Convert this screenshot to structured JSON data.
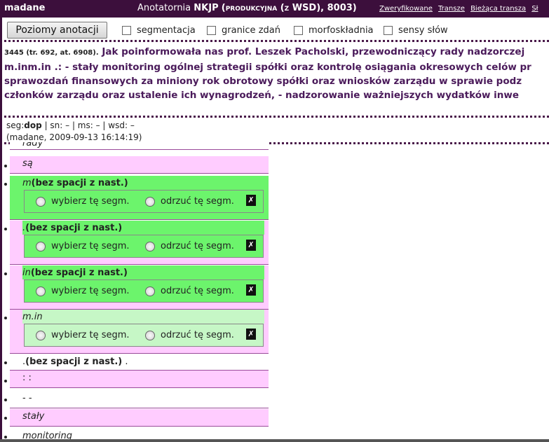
{
  "topbar": {
    "user": "madane",
    "app_prefix": "Anotatornia",
    "app_name": "NKJP",
    "app_mode": "(produkcyjna (z WSD), 8003)",
    "links": [
      "Zweryfikowane",
      "Transze",
      "Bieżąca transza",
      "Sł"
    ]
  },
  "toolbar": {
    "button_label": "Poziomy anotacji",
    "checkboxes": [
      "segmentacja",
      "granice zdań",
      "morfoskładnia",
      "sensy słów"
    ]
  },
  "text": {
    "ref": "3445 (tr. 692, at. 6908).",
    "line1": "Jak poinformowała nas prof. Leszek Pacholski, przewodniczący rady nadzorczej",
    "line2": "m.inm.in .: - stały monitoring ogólnej strategii spółki oraz kontrolę osiągania okresowych celów pr",
    "line3": "sprawozdań finansowych za miniony rok obrotowy spółki oraz wniosków zarządu w sprawie podz",
    "line4": "członków zarządu oraz ustalenie ich wynagrodzeń, - nadzorowanie ważniejszych wydatków inwe"
  },
  "info": {
    "seg_label": "seg:",
    "seg_value": "dop",
    "rest": "| sn: – | ms: – | wsd: –",
    "line2": "(madane, 2009-09-13 16:14:19)"
  },
  "segments": {
    "s0": "rady",
    "s1": "są",
    "s2": "m",
    "s2_ns": "(bez spacji z nast.)",
    "s3": ".",
    "s3_ns": "(bez spacji z nast.)",
    "s4": "in",
    "s4_ns": "(bez spacji z nast.)",
    "s5": "m.in",
    "s6": ".",
    "s6_ns": "(bez spacji z nast.)",
    "s6_tail": ".",
    "s7": ":  :",
    "s8": "-  -",
    "s9": "stały",
    "s10": "monitoring",
    "choose": "wybierz tę segm.",
    "reject": "odrzuć tę segm.",
    "x": "✗"
  },
  "colors": {
    "header_bg": "#3c0f3c",
    "pink": "#ffccff",
    "green": "#6cf46c",
    "light_green": "#c6f7c6"
  }
}
